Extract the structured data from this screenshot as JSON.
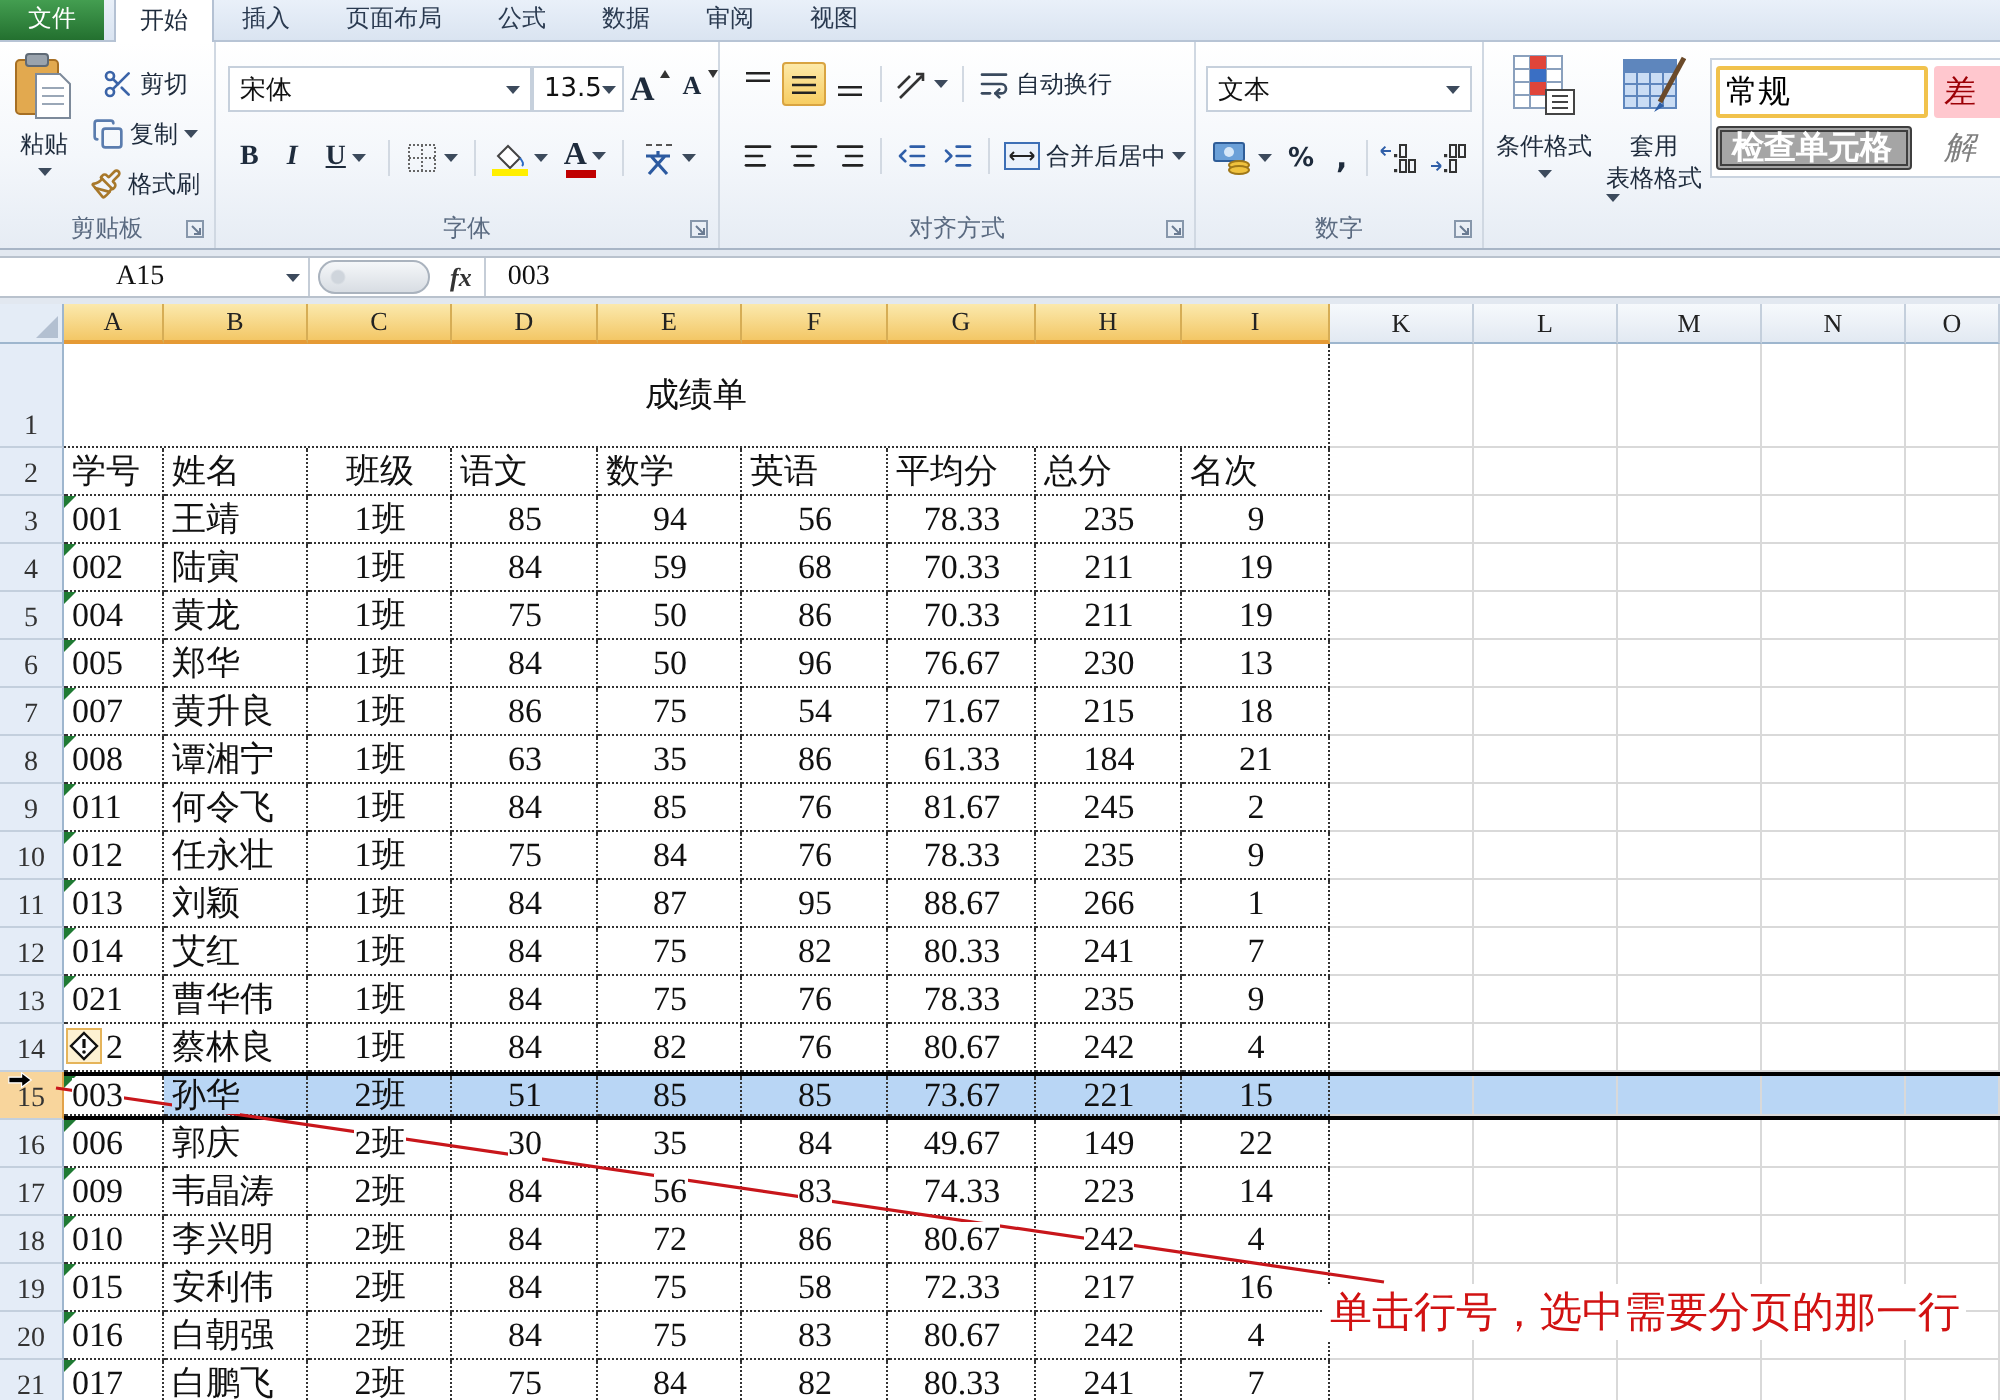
{
  "tabs": [
    {
      "label": "文件",
      "kind": "file",
      "selected": false
    },
    {
      "label": "开始",
      "kind": "tab",
      "selected": true
    },
    {
      "label": "插入",
      "kind": "tab",
      "selected": false
    },
    {
      "label": "页面布局",
      "kind": "tab",
      "selected": false
    },
    {
      "label": "公式",
      "kind": "tab",
      "selected": false
    },
    {
      "label": "数据",
      "kind": "tab",
      "selected": false
    },
    {
      "label": "审阅",
      "kind": "tab",
      "selected": false
    },
    {
      "label": "视图",
      "kind": "tab",
      "selected": false
    }
  ],
  "ribbon": {
    "clipboard": {
      "label": "剪贴板",
      "paste": "粘贴",
      "cut": "剪切",
      "copy": "复制",
      "format_painter": "格式刷"
    },
    "font": {
      "label": "字体",
      "font_name": "宋体",
      "font_size": "13.5",
      "grow": "A",
      "shrink": "A",
      "bold": "B",
      "italic": "I",
      "underline": "U",
      "font_color": "A"
    },
    "alignment": {
      "label": "对齐方式",
      "vertical": [
        {
          "kind": "top",
          "selected": false
        },
        {
          "kind": "middle",
          "selected": true
        },
        {
          "kind": "bottom",
          "selected": false
        }
      ],
      "horizontal": [
        {
          "kind": "left",
          "selected": false
        },
        {
          "kind": "center",
          "selected": false
        },
        {
          "kind": "right",
          "selected": false
        }
      ],
      "wrap_text": "自动换行",
      "merge_center": "合并后居中"
    },
    "number": {
      "label": "数字",
      "format": "文本",
      "percent": "%",
      "comma": ","
    },
    "styles": {
      "conditional_formatting": "条件格式",
      "format_as_table": [
        "套用",
        "表格格式"
      ],
      "cell_styles": [
        {
          "label": "常规",
          "kind": "normal",
          "selected": true
        },
        {
          "label": "差",
          "kind": "bad",
          "selected": false
        },
        {
          "label": "检查单元格",
          "kind": "check",
          "selected": false
        },
        {
          "label": "解",
          "kind": "explanatory",
          "selected": false
        }
      ]
    }
  },
  "formula_bar": {
    "name_box": "A15",
    "fx": "fx",
    "formula": "003"
  },
  "sheet": {
    "columns": [
      {
        "label": "A",
        "highlighted": true
      },
      {
        "label": "B",
        "highlighted": true
      },
      {
        "label": "C",
        "highlighted": true
      },
      {
        "label": "D",
        "highlighted": true
      },
      {
        "label": "E",
        "highlighted": true
      },
      {
        "label": "F",
        "highlighted": true
      },
      {
        "label": "G",
        "highlighted": true
      },
      {
        "label": "H",
        "highlighted": true
      },
      {
        "label": "I",
        "highlighted": true
      },
      {
        "label": "K",
        "highlighted": false
      },
      {
        "label": "L",
        "highlighted": false
      },
      {
        "label": "M",
        "highlighted": false
      },
      {
        "label": "N",
        "highlighted": false
      },
      {
        "label": "O",
        "highlighted": false
      }
    ],
    "title": {
      "row": "1",
      "text": "成绩单"
    },
    "header": {
      "row": "2",
      "cells": [
        "学号",
        "姓名",
        "班级",
        "语文",
        "数学",
        "英语",
        "平均分",
        "总分",
        "名次"
      ]
    },
    "rows": [
      {
        "row": "3",
        "selected": false,
        "flagged": true,
        "warning": false,
        "pointer": false,
        "cells": [
          "001",
          "王靖",
          "1班",
          "85",
          "94",
          "56",
          "78.33",
          "235",
          "9"
        ]
      },
      {
        "row": "4",
        "selected": false,
        "flagged": true,
        "warning": false,
        "pointer": false,
        "cells": [
          "002",
          "陆寅",
          "1班",
          "84",
          "59",
          "68",
          "70.33",
          "211",
          "19"
        ]
      },
      {
        "row": "5",
        "selected": false,
        "flagged": true,
        "warning": false,
        "pointer": false,
        "cells": [
          "004",
          "黄龙",
          "1班",
          "75",
          "50",
          "86",
          "70.33",
          "211",
          "19"
        ]
      },
      {
        "row": "6",
        "selected": false,
        "flagged": true,
        "warning": false,
        "pointer": false,
        "cells": [
          "005",
          "郑华",
          "1班",
          "84",
          "50",
          "96",
          "76.67",
          "230",
          "13"
        ]
      },
      {
        "row": "7",
        "selected": false,
        "flagged": true,
        "warning": false,
        "pointer": false,
        "cells": [
          "007",
          "黄升良",
          "1班",
          "86",
          "75",
          "54",
          "71.67",
          "215",
          "18"
        ]
      },
      {
        "row": "8",
        "selected": false,
        "flagged": true,
        "warning": false,
        "pointer": false,
        "cells": [
          "008",
          "谭湘宁",
          "1班",
          "63",
          "35",
          "86",
          "61.33",
          "184",
          "21"
        ]
      },
      {
        "row": "9",
        "selected": false,
        "flagged": true,
        "warning": false,
        "pointer": false,
        "cells": [
          "011",
          "何令飞",
          "1班",
          "84",
          "85",
          "76",
          "81.67",
          "245",
          "2"
        ]
      },
      {
        "row": "10",
        "selected": false,
        "flagged": true,
        "warning": false,
        "pointer": false,
        "cells": [
          "012",
          "任永壮",
          "1班",
          "75",
          "84",
          "76",
          "78.33",
          "235",
          "9"
        ]
      },
      {
        "row": "11",
        "selected": false,
        "flagged": true,
        "warning": false,
        "pointer": false,
        "cells": [
          "013",
          "刘颖",
          "1班",
          "84",
          "87",
          "95",
          "88.67",
          "266",
          "1"
        ]
      },
      {
        "row": "12",
        "selected": false,
        "flagged": true,
        "warning": false,
        "pointer": false,
        "cells": [
          "014",
          "艾红",
          "1班",
          "84",
          "75",
          "82",
          "80.33",
          "241",
          "7"
        ]
      },
      {
        "row": "13",
        "selected": false,
        "flagged": true,
        "warning": false,
        "pointer": false,
        "cells": [
          "021",
          "曹华伟",
          "1班",
          "84",
          "75",
          "76",
          "78.33",
          "235",
          "9"
        ]
      },
      {
        "row": "14",
        "selected": false,
        "flagged": false,
        "warning": true,
        "pointer": false,
        "cells": [
          "2",
          "蔡林良",
          "1班",
          "84",
          "82",
          "76",
          "80.67",
          "242",
          "4"
        ]
      },
      {
        "row": "15",
        "selected": true,
        "flagged": true,
        "warning": false,
        "pointer": true,
        "cells": [
          "003",
          "孙华",
          "2班",
          "51",
          "85",
          "85",
          "73.67",
          "221",
          "15"
        ]
      },
      {
        "row": "16",
        "selected": false,
        "flagged": true,
        "warning": false,
        "pointer": false,
        "cells": [
          "006",
          "郭庆",
          "2班",
          "30",
          "35",
          "84",
          "49.67",
          "149",
          "22"
        ]
      },
      {
        "row": "17",
        "selected": false,
        "flagged": true,
        "warning": false,
        "pointer": false,
        "cells": [
          "009",
          "韦晶涛",
          "2班",
          "84",
          "56",
          "83",
          "74.33",
          "223",
          "14"
        ]
      },
      {
        "row": "18",
        "selected": false,
        "flagged": true,
        "warning": false,
        "pointer": false,
        "cells": [
          "010",
          "李兴明",
          "2班",
          "84",
          "72",
          "86",
          "80.67",
          "242",
          "4"
        ]
      },
      {
        "row": "19",
        "selected": false,
        "flagged": true,
        "warning": false,
        "pointer": false,
        "cells": [
          "015",
          "安利伟",
          "2班",
          "84",
          "75",
          "58",
          "72.33",
          "217",
          "16"
        ]
      },
      {
        "row": "20",
        "selected": false,
        "flagged": true,
        "warning": false,
        "pointer": false,
        "cells": [
          "016",
          "白朝强",
          "2班",
          "84",
          "75",
          "83",
          "80.67",
          "242",
          "4"
        ]
      },
      {
        "row": "21",
        "selected": false,
        "flagged": true,
        "warning": false,
        "pointer": false,
        "cells": [
          "017",
          "白鹏飞",
          "2班",
          "75",
          "84",
          "82",
          "80.33",
          "241",
          "7"
        ]
      }
    ]
  },
  "annotation": {
    "text": "单击行号，选中需要分页的那一行"
  }
}
